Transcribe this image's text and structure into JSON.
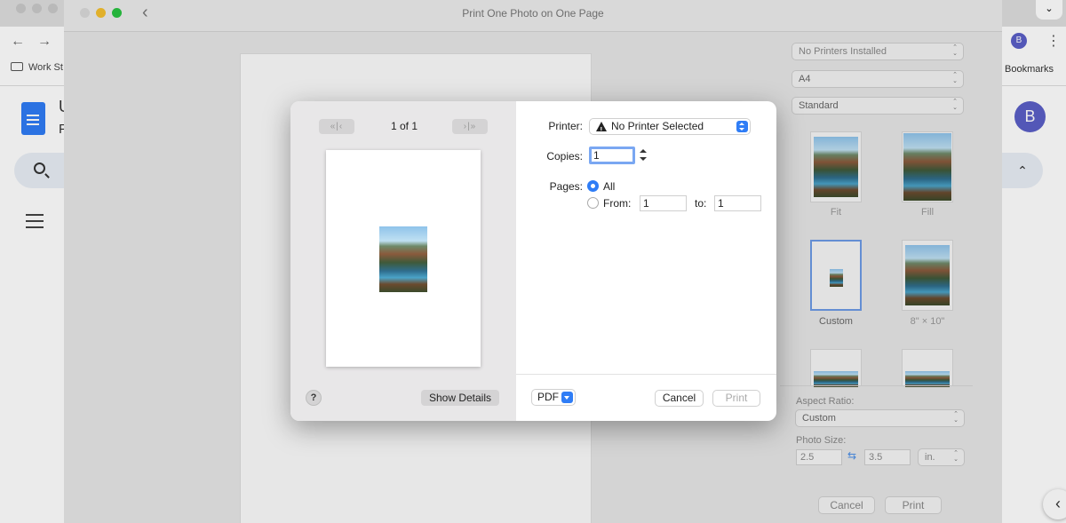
{
  "browser": {
    "bookmark_folder_label": "Work St",
    "doc_title_initial": "U",
    "doc_subtitle_initial": "F",
    "bookmarks_label": "Bookmarks",
    "avatar_letter_small": "B",
    "avatar_letter_large": "B"
  },
  "photos_window": {
    "title": "Print One Photo on One Page",
    "printer_select": "No Printers Installed",
    "paper_size_select": "A4",
    "quality_select": "Standard",
    "layouts": [
      {
        "label": "Fit"
      },
      {
        "label": "Fill"
      },
      {
        "label": "Custom",
        "selected": true
      },
      {
        "label": "8\" × 10\""
      }
    ],
    "aspect_ratio_label": "Aspect Ratio:",
    "aspect_ratio_value": "Custom",
    "photo_size_label": "Photo Size:",
    "photo_width": "2.5",
    "photo_height": "3.5",
    "photo_unit": "in.",
    "cancel_label": "Cancel",
    "print_label": "Print"
  },
  "print_dialog": {
    "page_counter": "1 of 1",
    "printer_label": "Printer:",
    "printer_value": "No Printer Selected",
    "copies_label": "Copies:",
    "copies_value": "1",
    "pages_label": "Pages:",
    "pages_all_label": "All",
    "pages_from_label": "From:",
    "pages_from_value": "1",
    "pages_to_label": "to:",
    "pages_to_value": "1",
    "help_label": "?",
    "show_details_label": "Show Details",
    "pdf_label": "PDF",
    "cancel_label": "Cancel",
    "print_label": "Print"
  },
  "colors": {
    "accent_blue": "#2f7df6",
    "avatar_purple": "#5b5fc7",
    "docs_blue": "#2f7cf6"
  }
}
